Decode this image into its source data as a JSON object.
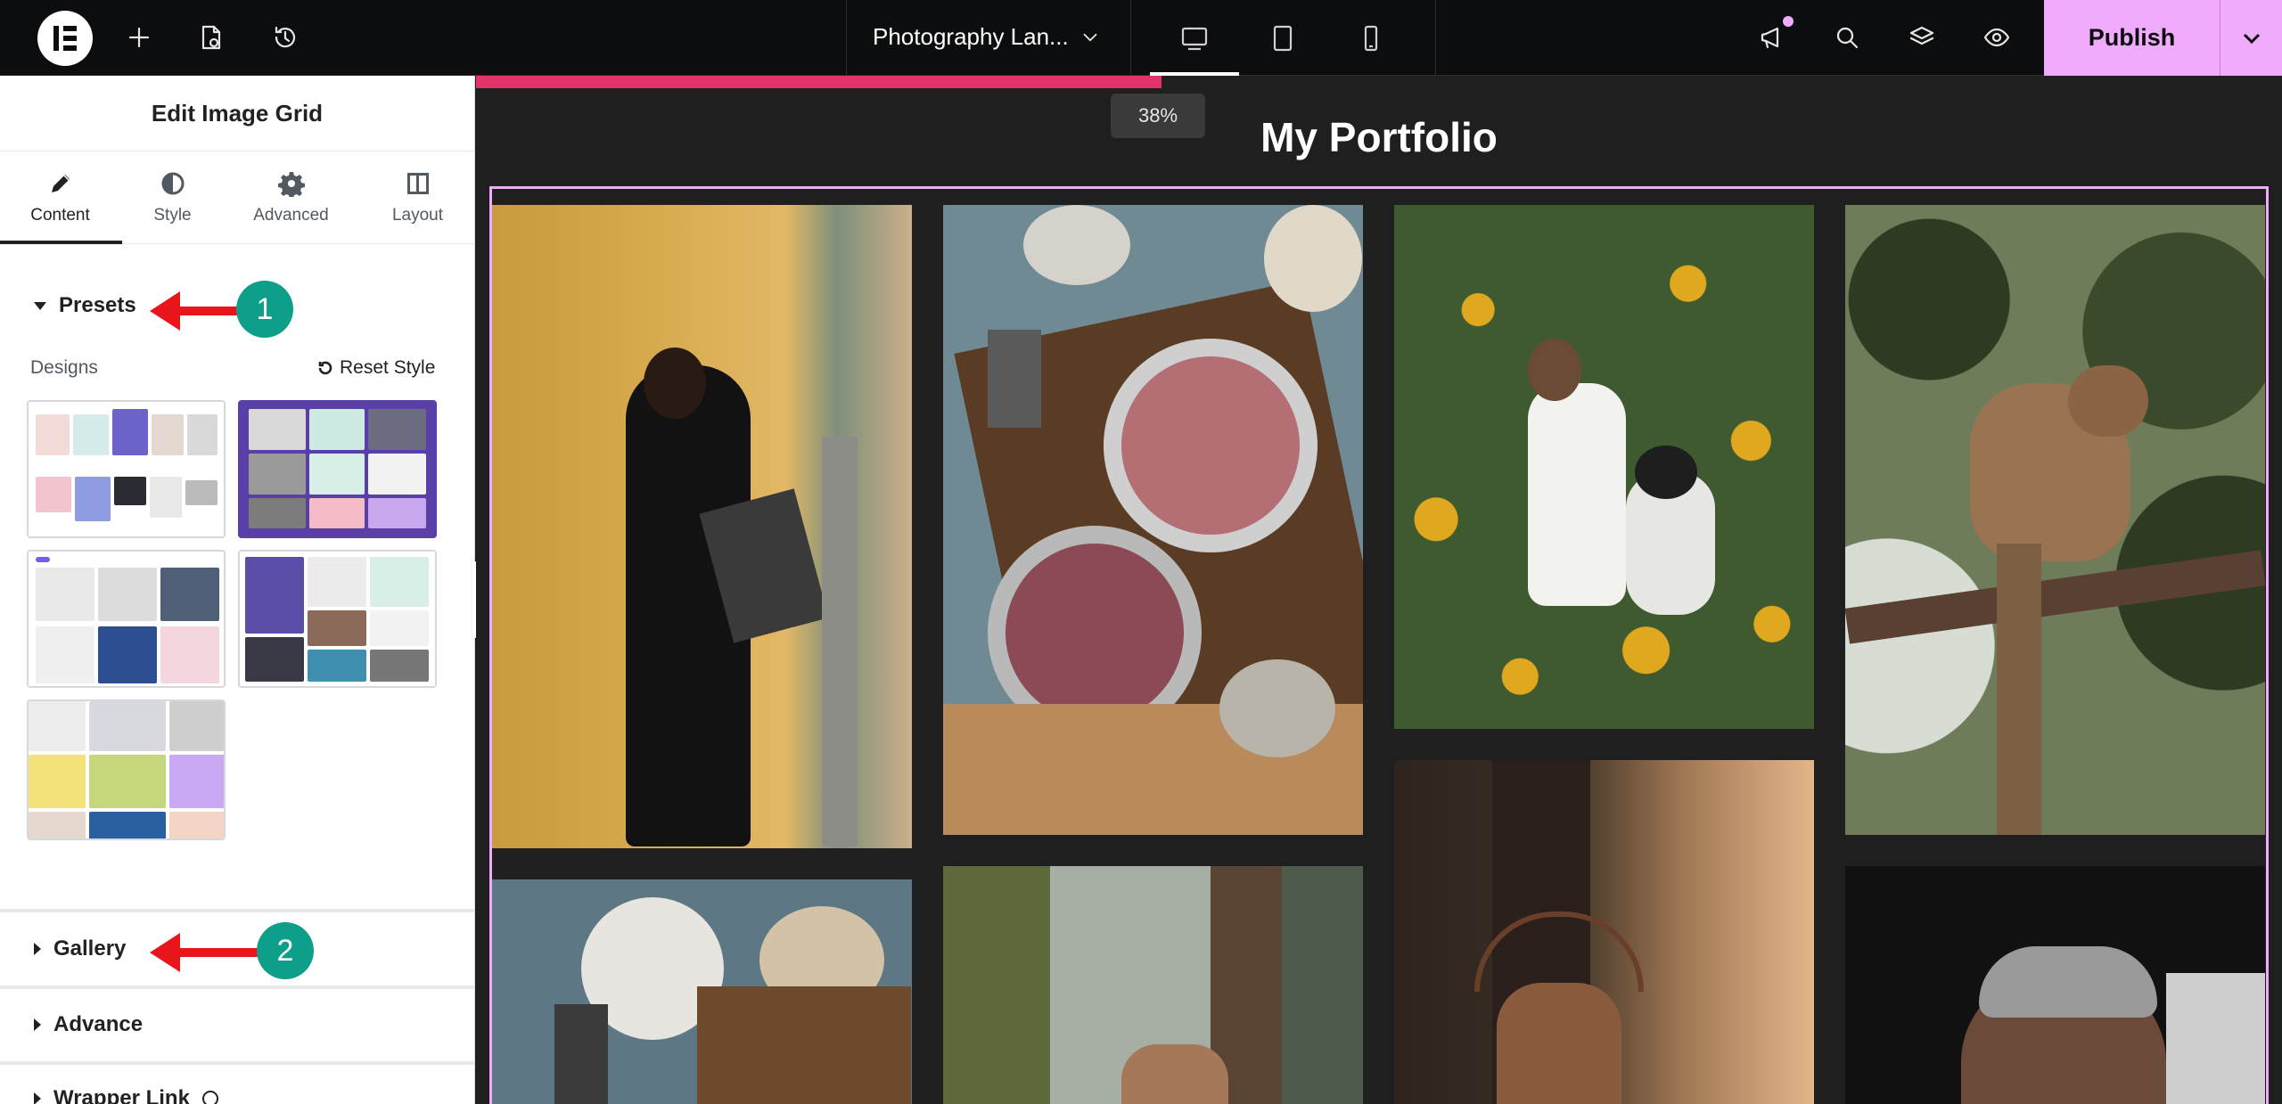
{
  "topbar": {
    "add_label": "Add",
    "page_title": "Photography Lan...",
    "publish_label": "Publish"
  },
  "panel": {
    "title": "Edit Image Grid",
    "tabs": [
      {
        "label": "Content",
        "icon": "pencil-icon",
        "active": true
      },
      {
        "label": "Style",
        "icon": "half-circle-icon",
        "active": false
      },
      {
        "label": "Advanced",
        "icon": "gear-icon",
        "active": false
      },
      {
        "label": "Layout",
        "icon": "layout-icon",
        "active": false
      }
    ],
    "presets_heading": "Presets",
    "designs_label": "Designs",
    "reset_style_label": "Reset Style",
    "sections": [
      "Gallery",
      "Advance",
      "Wrapper Link"
    ]
  },
  "annotations": {
    "badge_1": "1",
    "badge_2": "2",
    "color_arrow": "#e8161a",
    "color_badge": "#0e9f8a"
  },
  "canvas": {
    "zoom_label": "38%",
    "portfolio_title": "My Portfolio",
    "accent_color": "#f0abfc",
    "progress_color": "#e2336b",
    "photos": [
      "woman-in-black-dress-alley",
      "smoothie-bowls-overhead",
      "couple-in-sunflower-field",
      "coati-in-tree",
      "smoothie-bowls-overhead",
      "deer-in-forest",
      "stag-in-forest",
      "elderly-man-portrait"
    ]
  }
}
